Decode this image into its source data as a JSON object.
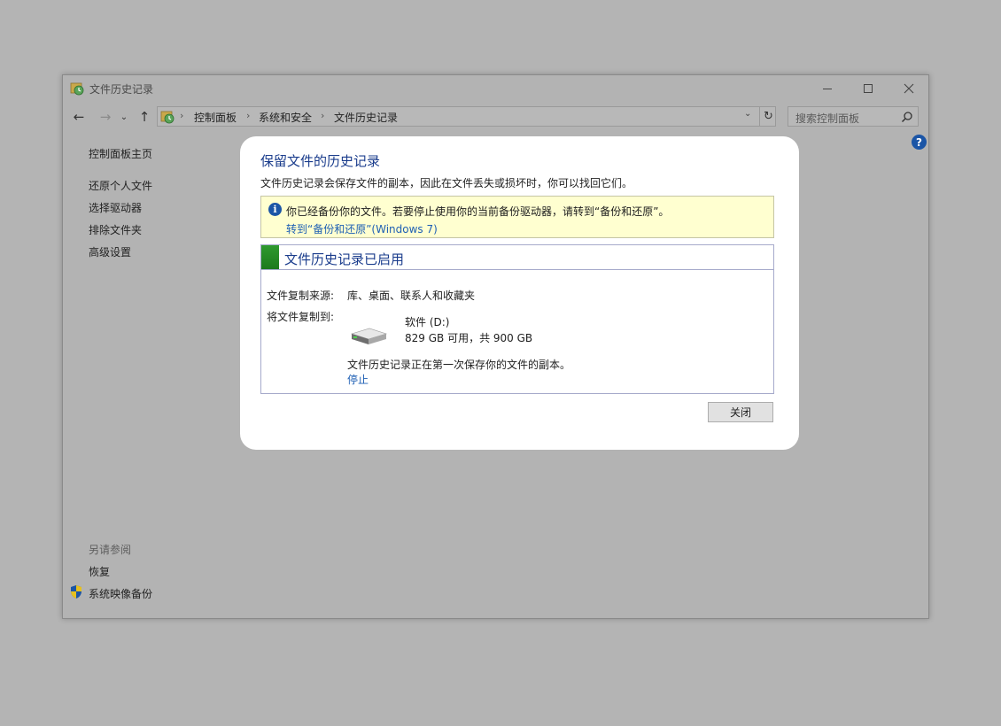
{
  "window": {
    "title": "文件历史记录"
  },
  "nav": {
    "back": "←",
    "forward": "→",
    "recent": "⌄",
    "up": "↑",
    "refresh": "↻",
    "dropdown": "⌄",
    "separator": "›",
    "breadcrumbs": [
      "控制面板",
      "系统和安全",
      "文件历史记录"
    ],
    "search_placeholder": "搜索控制面板"
  },
  "help": {
    "label": "?"
  },
  "sidebar": {
    "home": "控制面板主页",
    "items": [
      "还原个人文件",
      "选择驱动器",
      "排除文件夹",
      "高级设置"
    ],
    "see_also_heading": "另请参阅",
    "see_also": [
      "恢复",
      "系统映像备份"
    ]
  },
  "dialog": {
    "title": "保留文件的历史记录",
    "description": "文件历史记录会保存文件的副本，因此在文件丢失或损坏时，你可以找回它们。",
    "info": {
      "icon": "i",
      "text": "你已经备份你的文件。若要停止使用你的当前备份驱动器，请转到“备份和还原”。",
      "link": "转到“备份和还原”(Windows 7)"
    },
    "status": {
      "title": "文件历史记录已启用",
      "copy_from_label": "文件复制来源:",
      "copy_from_value": "库、桌面、联系人和收藏夹",
      "copy_to_label": "将文件复制到:",
      "drive_name": "软件 (D:)",
      "drive_space": "829 GB 可用，共 900 GB",
      "progress_text": "文件历史记录正在第一次保存你的文件的副本。",
      "stop_link": "停止"
    },
    "close_button": "关闭"
  },
  "colors": {
    "title_blue": "#1a3c8c",
    "link_blue": "#1e5fb4",
    "info_bg": "#ffffd0",
    "status_green": "#2f9a2f"
  },
  "icons": {
    "app": "file-history-icon",
    "search": "search-icon",
    "help": "help-icon",
    "info": "info-icon",
    "drive": "hard-drive-icon",
    "shield": "shield-icon"
  }
}
